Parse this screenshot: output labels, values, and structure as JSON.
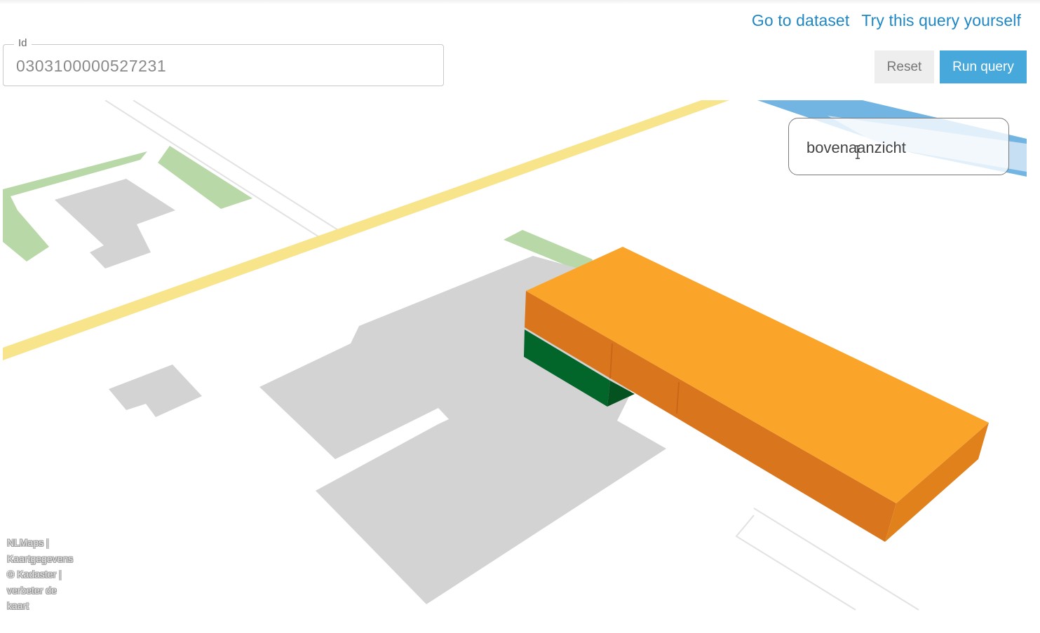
{
  "header": {
    "links": {
      "go_to_dataset": "Go to dataset",
      "try_query": "Try this query yourself"
    }
  },
  "query_form": {
    "id_label": "Id",
    "id_value": "0303100000527231",
    "reset_label": "Reset",
    "run_label": "Run query"
  },
  "map": {
    "view_toggle_label": "bovenaanzicht",
    "attribution": [
      "NLMaps |",
      "Kaartgegevens",
      "© Kadaster |",
      "verbeter de",
      "kaart"
    ],
    "colors": {
      "road_yellow": "#f8e48a",
      "water_blue": "#72b4e2",
      "vegetation_green": "#b8d8a8",
      "building_grey": "#d3d3d3",
      "selected_building_top": "#faa52a",
      "selected_building_side": "#d9761d",
      "neighbour_building": "#02662b"
    },
    "icons": [
      "text-cursor-icon"
    ]
  }
}
